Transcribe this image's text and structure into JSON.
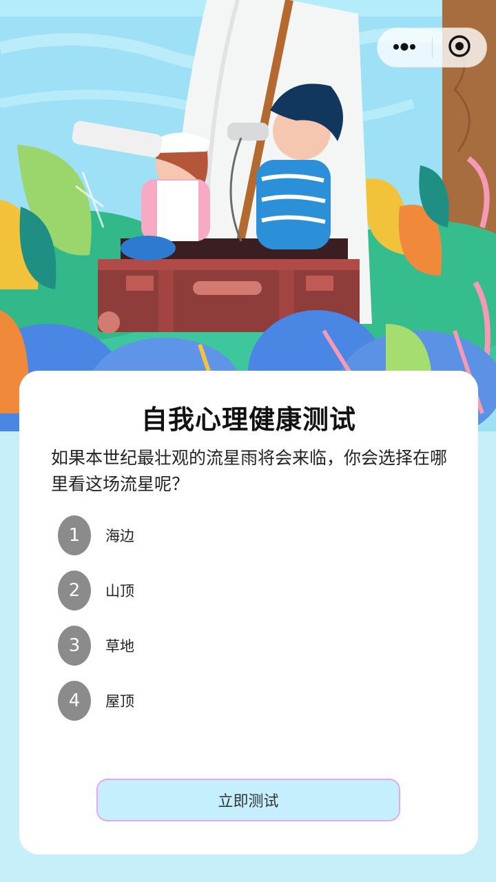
{
  "capsule": {
    "more_icon": "more-dots-icon",
    "close_icon": "target-circle-icon"
  },
  "card": {
    "title": "自我心理健康测试",
    "question": "如果本世纪最壮观的流星雨将会来临，你会选择在哪里看这场流星呢？",
    "options": [
      {
        "number": "1",
        "label": "海边"
      },
      {
        "number": "2",
        "label": "山顶"
      },
      {
        "number": "3",
        "label": "草地"
      },
      {
        "number": "4",
        "label": "屋顶"
      }
    ],
    "start_button": "立即测试"
  },
  "colors": {
    "page_background": "#c6effa",
    "card_background": "#ffffff",
    "option_circle": "#8b8b8b",
    "button_fill": "#c5effc",
    "button_border": "#e6a6f6"
  }
}
